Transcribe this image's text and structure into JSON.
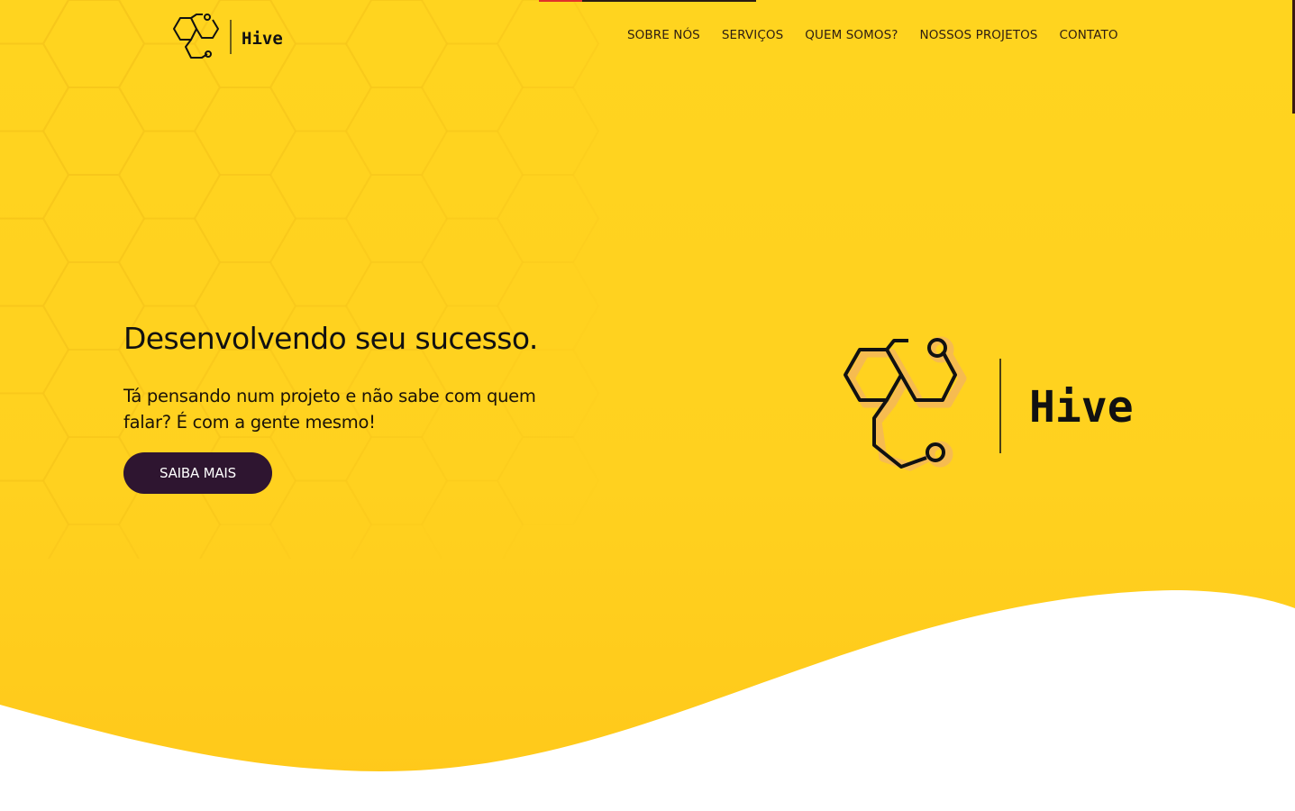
{
  "brand": {
    "name": "Hive",
    "logo_icon": "hexagon-molecule-icon"
  },
  "nav": {
    "items": [
      {
        "label": "SOBRE NÓS"
      },
      {
        "label": "SERVIÇOS"
      },
      {
        "label": "QUEM SOMOS?"
      },
      {
        "label": "NOSSOS PROJETOS"
      },
      {
        "label": "CONTATO"
      }
    ]
  },
  "hero": {
    "headline": "Desenvolvendo seu sucesso.",
    "subtitle": "Tá pensando num projeto e não sabe com quem falar? É com a gente mesmo!",
    "cta_label": "SAIBA MAIS"
  },
  "colors": {
    "accent": "#ffd41f",
    "button": "#2e1530",
    "text": "#111111",
    "logo_highlight": "#f5b85a"
  }
}
